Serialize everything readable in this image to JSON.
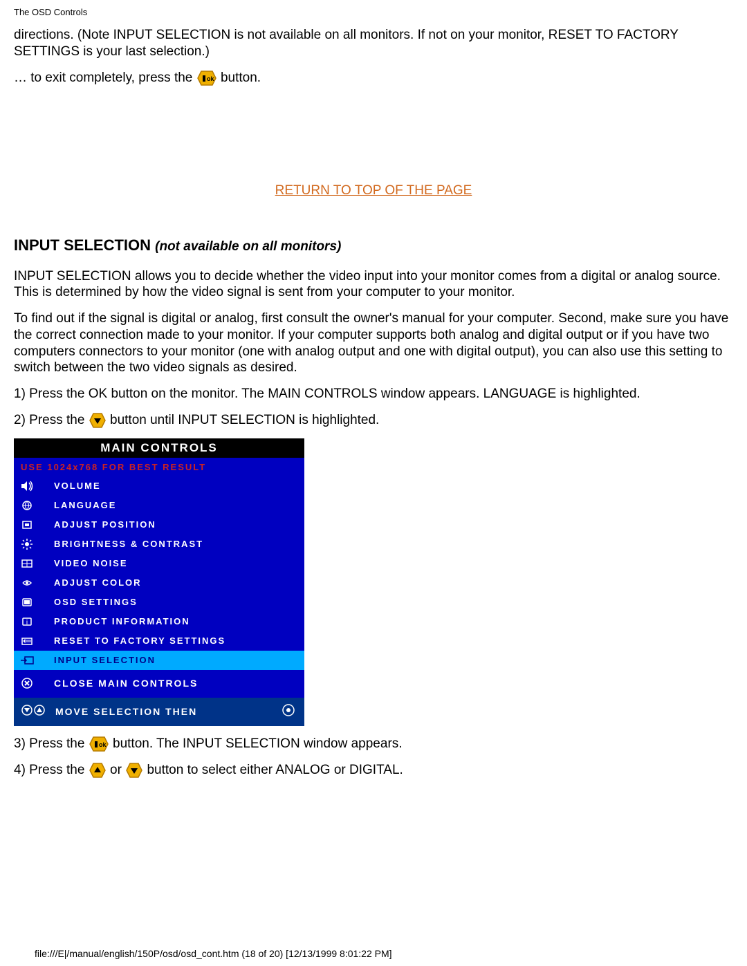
{
  "headerSmall": "The OSD Controls",
  "para1": "directions. (Note INPUT SELECTION is not available on all monitors. If not on your monitor, RESET TO FACTORY SETTINGS is your last selection.)",
  "exitPrefix": "… to exit completely, press the ",
  "exitSuffix": " button.",
  "returnLink": "RETURN TO TOP OF THE PAGE",
  "heading": "INPUT SELECTION",
  "headingNote": "not available on all monitors)",
  "desc1": "INPUT SELECTION allows you to decide whether the video input into your monitor comes from a digital or analog source. This is determined by how the video signal is sent from your computer to your monitor.",
  "desc2": "To find out if the signal is digital or analog, first consult the owner's manual for your computer. Second, make sure you have the correct connection made to your monitor. If your computer supports both analog and digital output or if you have two computers connectors to your monitor (one with analog output and one with digital output), you can also use this setting to switch between the two video signals as desired.",
  "step1": "1) Press the OK button on the monitor. The MAIN CONTROLS window appears. LANGUAGE is highlighted.",
  "step2Prefix": "2) Press the ",
  "step2Suffix": " button until INPUT SELECTION is highlighted.",
  "osd": {
    "title": "MAIN CONTROLS",
    "warn": "USE 1024x768 FOR BEST RESULT",
    "items": [
      {
        "label": "VOLUME"
      },
      {
        "label": "LANGUAGE"
      },
      {
        "label": "ADJUST POSITION"
      },
      {
        "label": "BRIGHTNESS & CONTRAST"
      },
      {
        "label": "VIDEO NOISE"
      },
      {
        "label": "ADJUST COLOR"
      },
      {
        "label": "OSD SETTINGS"
      },
      {
        "label": "PRODUCT INFORMATION"
      },
      {
        "label": "RESET TO FACTORY SETTINGS"
      },
      {
        "label": "INPUT SELECTION",
        "highlight": true
      }
    ],
    "close": "CLOSE MAIN CONTROLS",
    "footer": "MOVE SELECTION THEN"
  },
  "step3Prefix": "3) Press the ",
  "step3Suffix": " button. The INPUT SELECTION window appears.",
  "step4a": "4) Press the ",
  "step4b": " or ",
  "step4c": " button to select either ANALOG or DIGITAL.",
  "footerText": "file:///E|/manual/english/150P/osd/osd_cont.htm (18 of 20) [12/13/1999 8:01:22 PM]"
}
